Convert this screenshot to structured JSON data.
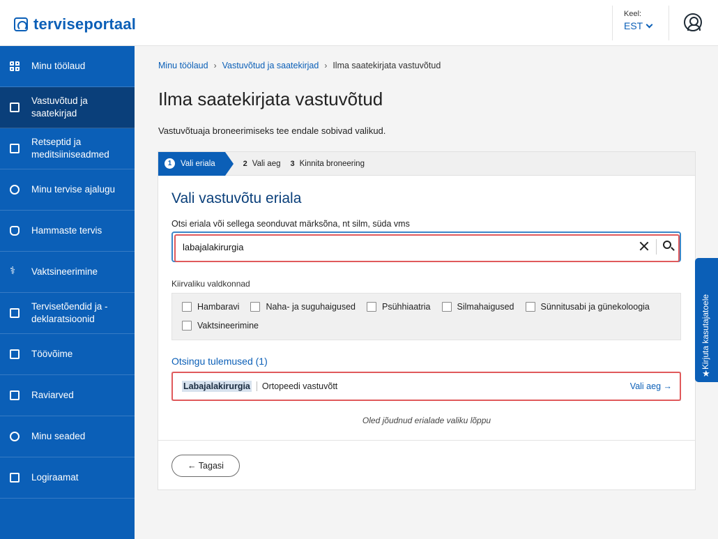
{
  "app": {
    "logo_text": "terviseportaal"
  },
  "header": {
    "lang_label": "Keel:",
    "lang_value": "EST"
  },
  "sidebar": {
    "items": [
      {
        "label": "Minu töölaud",
        "icon": "dashboard-icon"
      },
      {
        "label": "Vastuvõtud ja saatekirjad",
        "icon": "calendar-icon",
        "active": true
      },
      {
        "label": "Retseptid ja meditsiiniseadmed",
        "icon": "prescription-icon"
      },
      {
        "label": "Minu tervise ajalugu",
        "icon": "history-icon"
      },
      {
        "label": "Hammaste tervis",
        "icon": "tooth-icon"
      },
      {
        "label": "Vaktsineerimine",
        "icon": "vaccine-icon"
      },
      {
        "label": "Tervisetõendid ja -deklaratsioonid",
        "icon": "clipboard-icon"
      },
      {
        "label": "Töövõime",
        "icon": "briefcase-icon"
      },
      {
        "label": "Raviarved",
        "icon": "card-icon"
      },
      {
        "label": "Minu seaded",
        "icon": "gear-icon"
      },
      {
        "label": "Logiraamat",
        "icon": "book-icon"
      }
    ]
  },
  "breadcrumb": {
    "items": [
      "Minu töölaud",
      "Vastuvõtud ja saatekirjad"
    ],
    "current": "Ilma saatekirjata vastuvõtud"
  },
  "page": {
    "title": "Ilma saatekirjata vastuvõtud",
    "intro": "Vastuvõtuaja broneerimiseks tee endale sobivad valikud."
  },
  "stepper": {
    "steps": [
      {
        "num": "1",
        "label": "Vali eriala"
      },
      {
        "num": "2",
        "label": "Vali aeg"
      },
      {
        "num": "3",
        "label": "Kinnita broneering"
      }
    ]
  },
  "search": {
    "section_title": "Vali vastuvõtu eriala",
    "label": "Otsi eriala või sellega seonduvat märksõna, nt silm, süda vms",
    "value": "labajalakirurgia"
  },
  "quick": {
    "label": "Kiirvaliku valdkonnad",
    "options": [
      "Hambaravi",
      "Naha- ja suguhaigused",
      "Psühhiaatria",
      "Silmahaigused",
      "Sünnitusabi ja günekoloogia",
      "Vaktsineerimine"
    ]
  },
  "results": {
    "title": "Otsingu tulemused (1)",
    "items": [
      {
        "name": "Labajalakirurgia",
        "type": "Ortopeedi vastuvõtt",
        "action": "Vali aeg →"
      }
    ],
    "end_note": "Oled jõudnud erialade valiku lõppu"
  },
  "footer": {
    "back_label": "← Tagasi"
  },
  "feedback": {
    "label": "Kirjuta kasutajatoele"
  },
  "colors": {
    "primary": "#0b5fb7",
    "sidebar_active": "#0a3f7a",
    "highlight": "#e0595b"
  }
}
